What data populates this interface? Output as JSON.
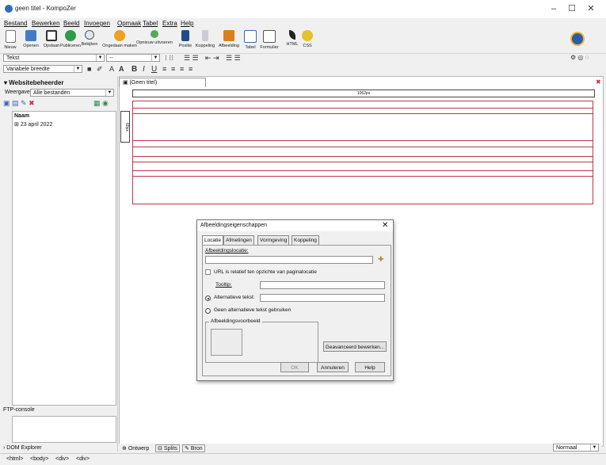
{
  "window": {
    "title": "geen titel - KompoZer",
    "minimize": "–",
    "maximize": "☐",
    "close": "✕"
  },
  "menu": [
    "Bestand",
    "Bewerken",
    "Beeld",
    "Invoegen",
    "Opmaak",
    "Tabel",
    "Extra",
    "Help"
  ],
  "toolbar": [
    {
      "label": "Nieuw",
      "icon": "new-page-icon"
    },
    {
      "label": "Openen",
      "icon": "open-folder-icon"
    },
    {
      "label": "Opslaan",
      "icon": "save-disk-icon"
    },
    {
      "label": "Publiceren",
      "icon": "publish-globe-icon"
    },
    {
      "label": "Bekijken",
      "icon": "magnifier-icon"
    },
    {
      "label": "Ongedaan maken",
      "icon": "undo-arrow-icon"
    },
    {
      "label": "Opnieuw uitvoeren",
      "icon": "redo-arrow-icon"
    },
    {
      "label": "Positie",
      "icon": "anchor-icon"
    },
    {
      "label": "Koppeling",
      "icon": "chain-link-icon"
    },
    {
      "label": "Afbeelding",
      "icon": "image-icon"
    },
    {
      "label": "Tabel",
      "icon": "table-icon"
    },
    {
      "label": "Formulier",
      "icon": "form-icon"
    },
    {
      "label": "HTML",
      "icon": "html-validate-icon"
    },
    {
      "label": "CSS",
      "icon": "css-icon"
    }
  ],
  "format": {
    "paragraph_style": "Tekst",
    "font": "--",
    "width_mode": "Variabele breedte"
  },
  "sidebar": {
    "title": "Websitebeheerder",
    "view_label": "Weergave:",
    "view_value": "Alle bestanden",
    "name_header": "Naam",
    "tree_item": "23 april 2022",
    "ftp_label": "FTP-console",
    "dom_label": "DOM Explorer"
  },
  "editor": {
    "tab_title": "(Geen titel)",
    "ruler_label": "1062px",
    "vruler_label": "60px"
  },
  "dialog": {
    "title": "Afbeeldingseigenschappen",
    "tabs": [
      "Locatie",
      "Afmetingen",
      "Vormgeving",
      "Koppeling"
    ],
    "location_label": "Afbeeldingslocatie:",
    "url_relative": "URL is relatief ten opzichte van paginalocatie",
    "tooltip_label": "Tooltip:",
    "alt_text_label": "Alternatieve tekst:",
    "no_alt_label": "Geen alternatieve tekst gebruiken",
    "preview_label": "Afbeeldingsvoorbeeld",
    "advanced_button": "Geavanceerd bewerken...",
    "ok": "OK",
    "cancel": "Annuleren",
    "help": "Help"
  },
  "bottom_tabs": [
    "Ontwerp",
    "Splits",
    "Bron"
  ],
  "mode": "Normaal",
  "status_tags": [
    "<html>",
    "<body>",
    "<div>",
    "<div>"
  ]
}
